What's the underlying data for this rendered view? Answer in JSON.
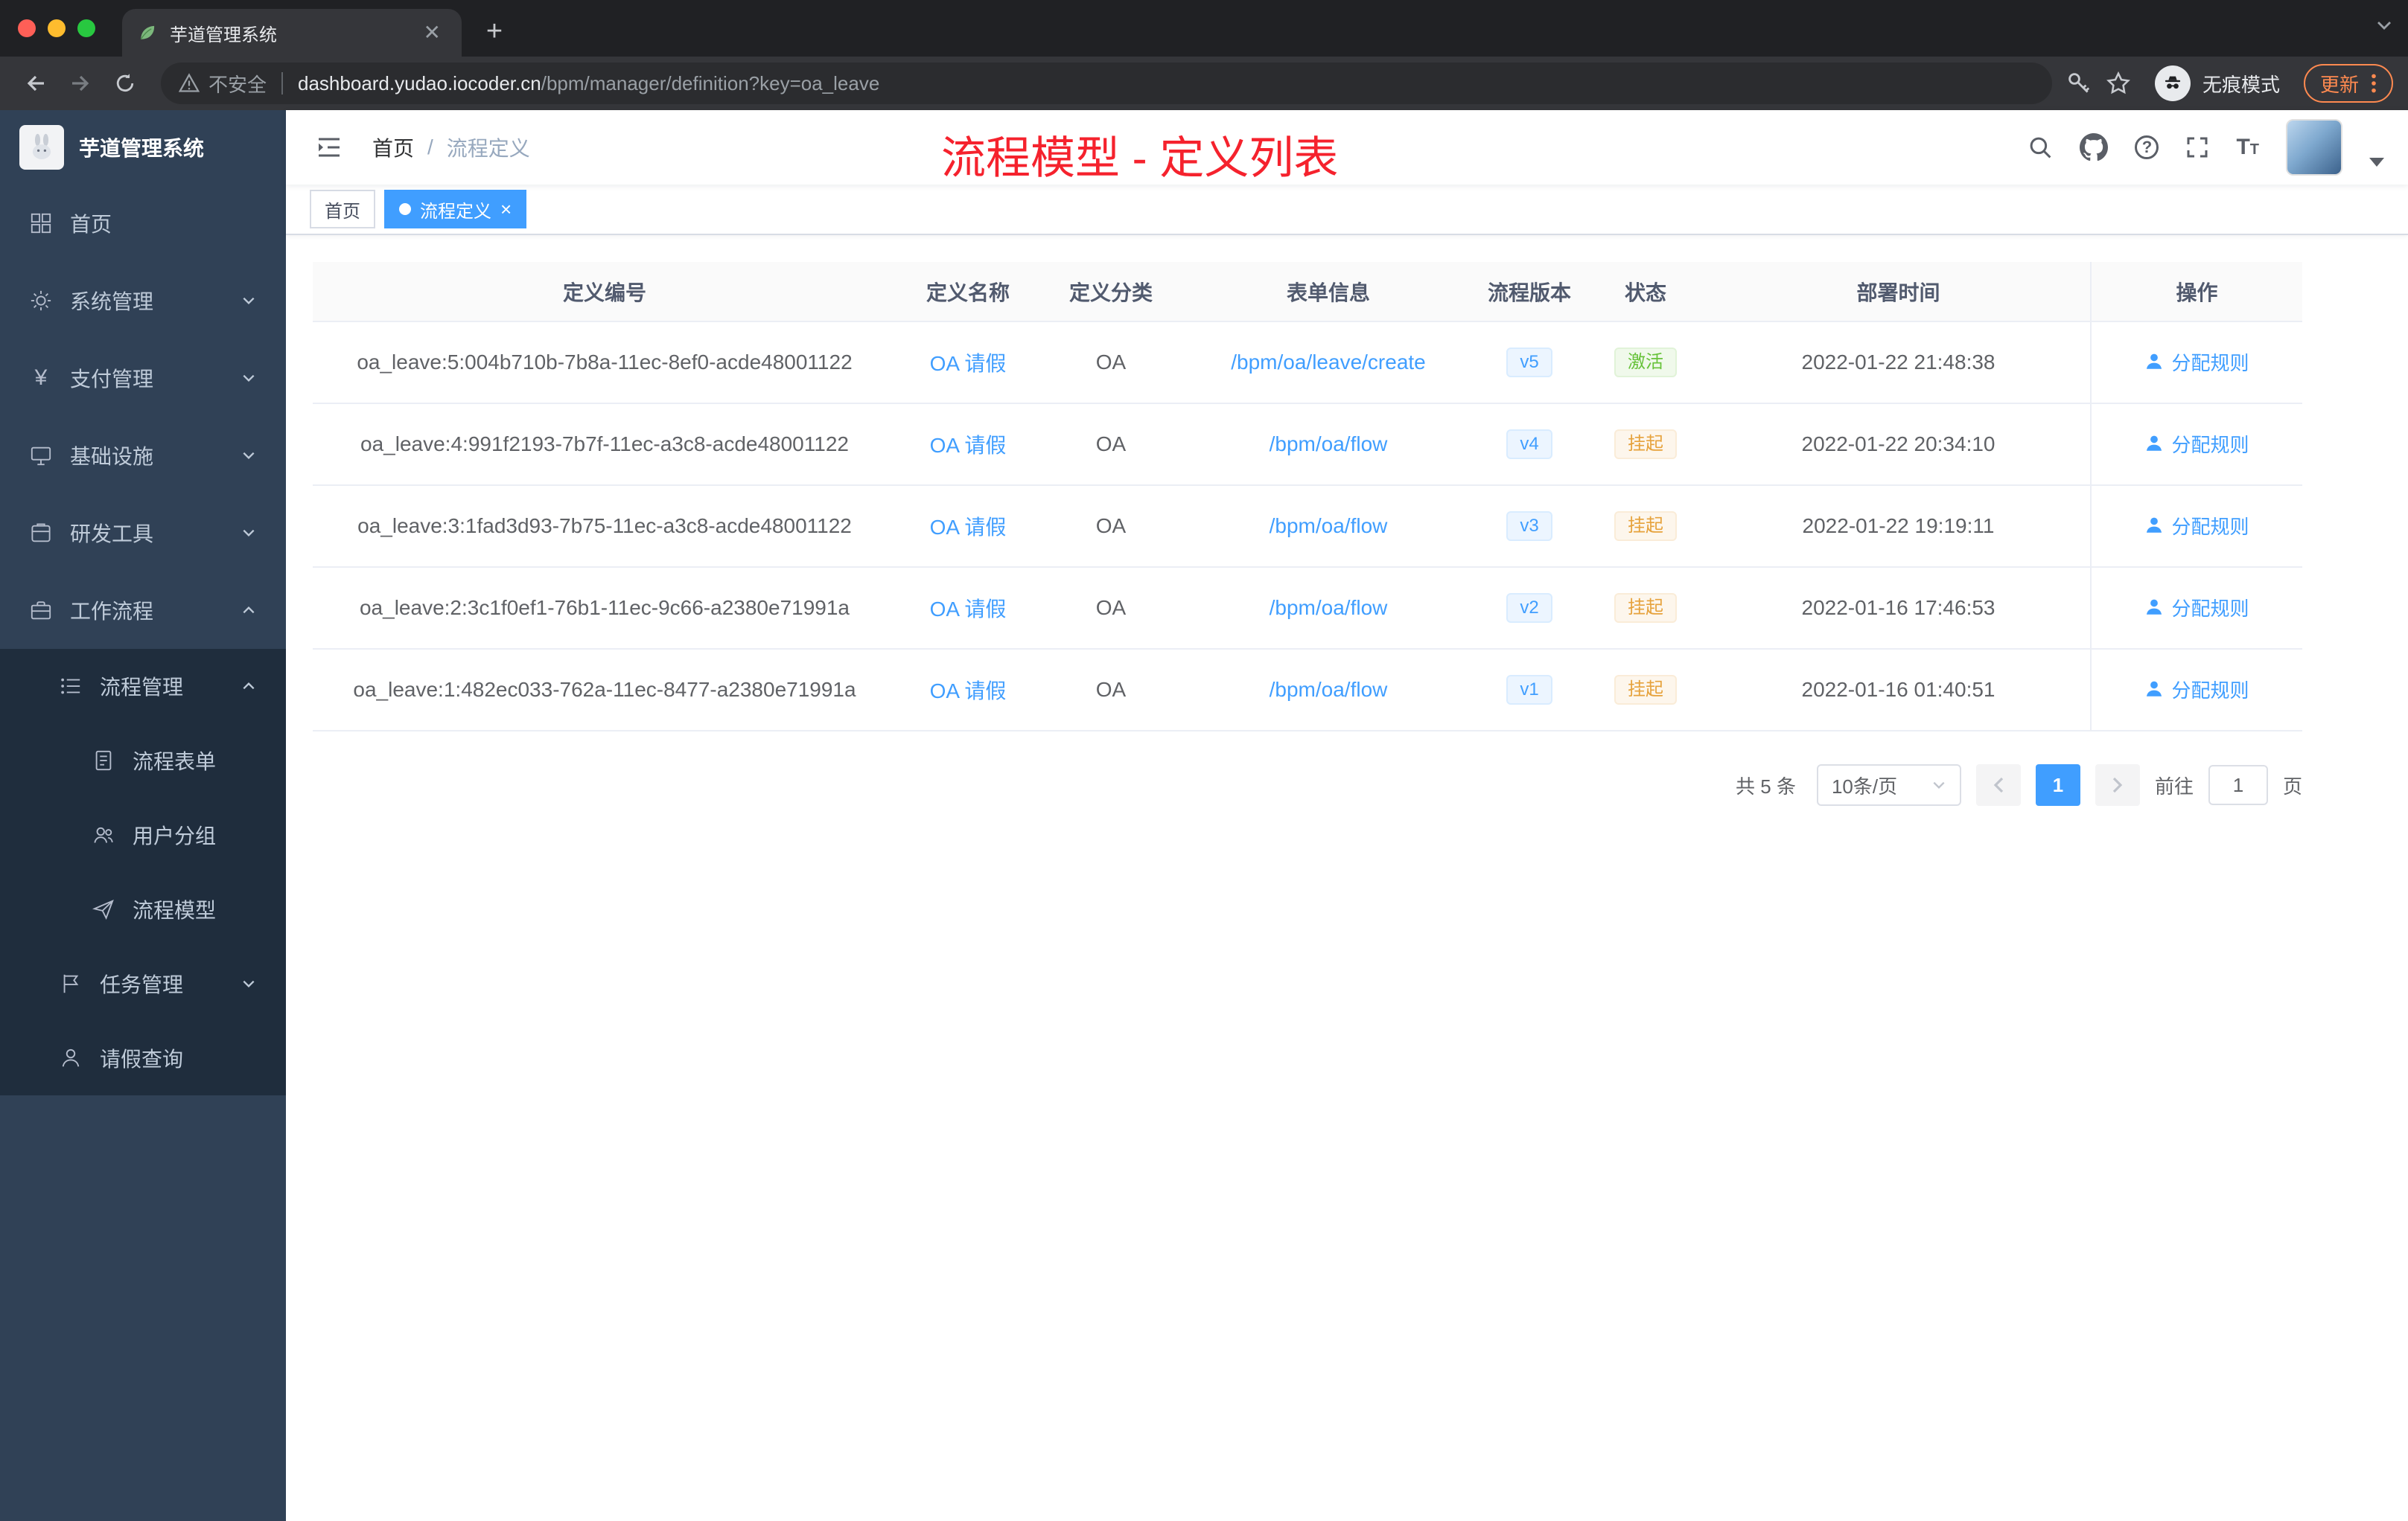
{
  "colors": {
    "accent": "#409EFF",
    "success": "#67C23A",
    "warning": "#E6A23C",
    "annotation_red": "#F5222D",
    "sidebar_bg": "#304156"
  },
  "browser": {
    "tab_title": "芋道管理系统",
    "not_secure_label": "不安全",
    "url_domain": "dashboard.yudao.iocoder.cn",
    "url_path": "/bpm/manager/definition?key=oa_leave",
    "incognito_label": "无痕模式",
    "update_label": "更新"
  },
  "sidebar": {
    "app_title": "芋道管理系统",
    "items": [
      {
        "label": "首页"
      },
      {
        "label": "系统管理"
      },
      {
        "label": "支付管理"
      },
      {
        "label": "基础设施"
      },
      {
        "label": "研发工具"
      },
      {
        "label": "工作流程"
      },
      {
        "label": "流程管理"
      },
      {
        "label": "流程表单"
      },
      {
        "label": "用户分组"
      },
      {
        "label": "流程模型"
      },
      {
        "label": "任务管理"
      },
      {
        "label": "请假查询"
      }
    ]
  },
  "header": {
    "breadcrumb_home": "首页",
    "breadcrumb_sep": "/",
    "breadcrumb_current": "流程定义",
    "annotation": "流程模型 - 定义列表"
  },
  "tags_bar": {
    "tags": [
      {
        "label": "首页"
      },
      {
        "label": "流程定义"
      }
    ]
  },
  "table": {
    "columns": [
      "定义编号",
      "定义名称",
      "定义分类",
      "表单信息",
      "流程版本",
      "状态",
      "部署时间",
      "操作"
    ],
    "rows": [
      {
        "id": "oa_leave:5:004b710b-7b8a-11ec-8ef0-acde48001122",
        "name": "OA 请假",
        "category": "OA",
        "form": "/bpm/oa/leave/create",
        "version": "v5",
        "status": "激活",
        "time": "2022-01-22 21:48:38",
        "action": "分配规则"
      },
      {
        "id": "oa_leave:4:991f2193-7b7f-11ec-a3c8-acde48001122",
        "name": "OA 请假",
        "category": "OA",
        "form": "/bpm/oa/flow",
        "version": "v4",
        "status": "挂起",
        "time": "2022-01-22 20:34:10",
        "action": "分配规则"
      },
      {
        "id": "oa_leave:3:1fad3d93-7b75-11ec-a3c8-acde48001122",
        "name": "OA 请假",
        "category": "OA",
        "form": "/bpm/oa/flow",
        "version": "v3",
        "status": "挂起",
        "time": "2022-01-22 19:19:11",
        "action": "分配规则"
      },
      {
        "id": "oa_leave:2:3c1f0ef1-76b1-11ec-9c66-a2380e71991a",
        "name": "OA 请假",
        "category": "OA",
        "form": "/bpm/oa/flow",
        "version": "v2",
        "status": "挂起",
        "time": "2022-01-16 17:46:53",
        "action": "分配规则"
      },
      {
        "id": "oa_leave:1:482ec033-762a-11ec-8477-a2380e71991a",
        "name": "OA 请假",
        "category": "OA",
        "form": "/bpm/oa/flow",
        "version": "v1",
        "status": "挂起",
        "time": "2022-01-16 01:40:51",
        "action": "分配规则"
      }
    ]
  },
  "pagination": {
    "total": "共 5 条",
    "page_size": "10条/页",
    "page": "1",
    "goto_label": "前往",
    "goto_value": "1",
    "unit_label": "页"
  }
}
